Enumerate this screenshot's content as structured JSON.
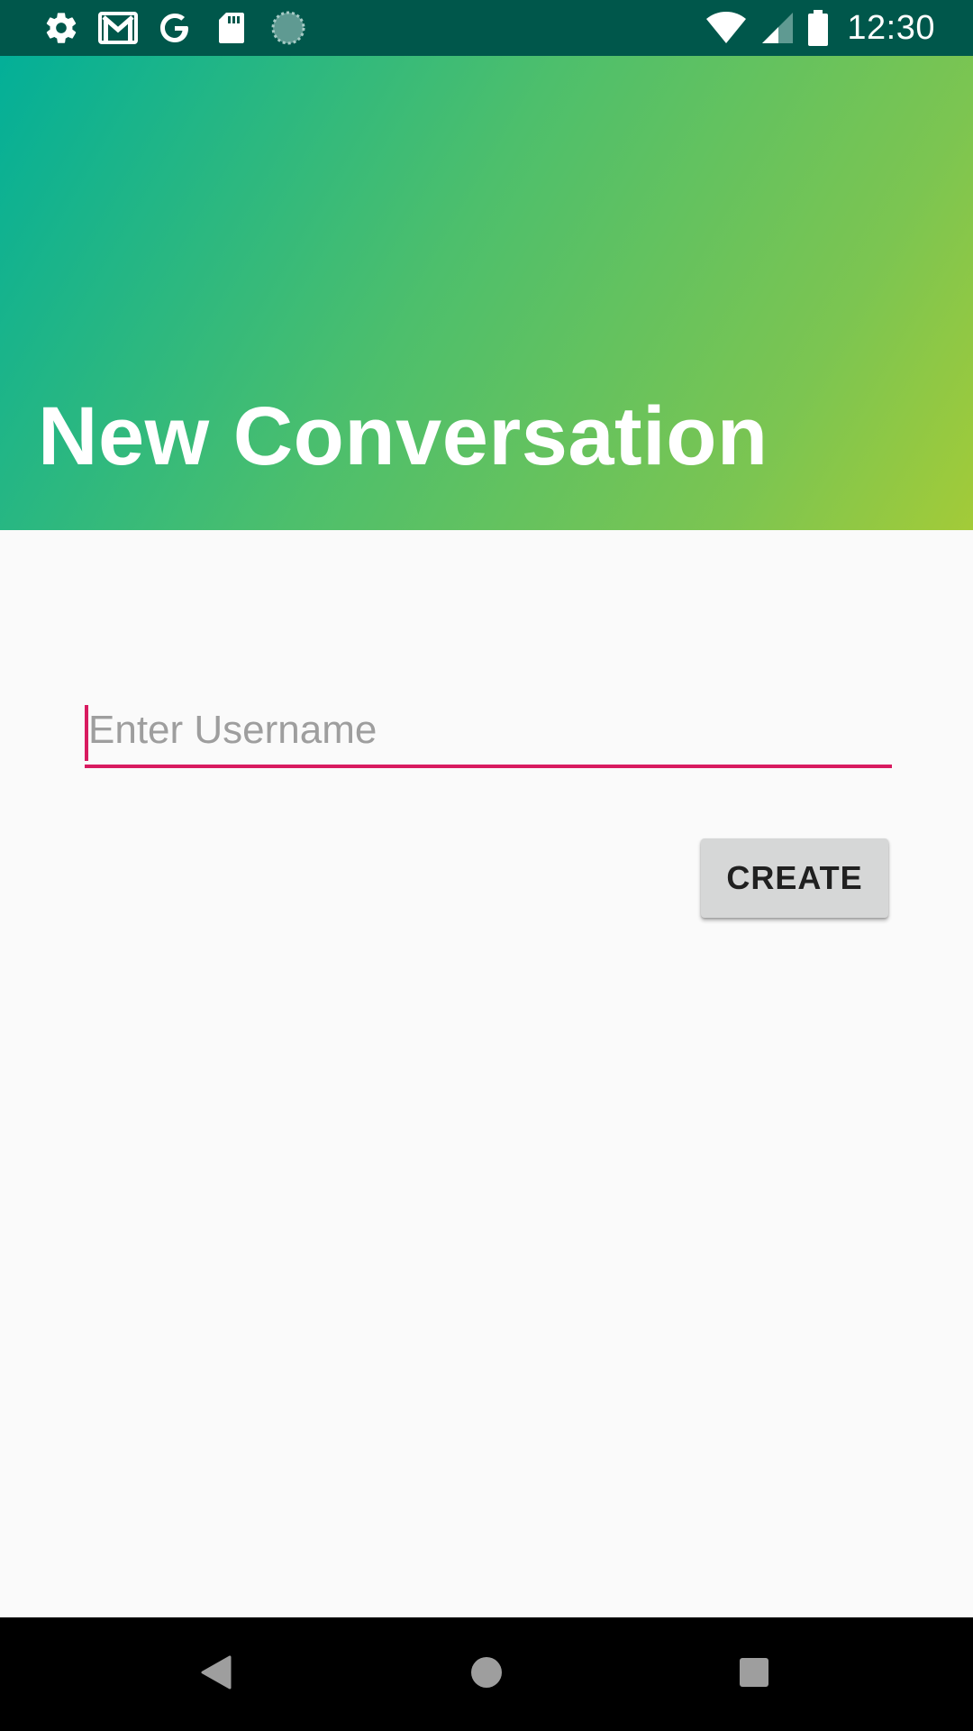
{
  "status_bar": {
    "time": "12:30",
    "left_icons": [
      "settings-icon",
      "gmail-icon",
      "google-icon",
      "sd-card-icon",
      "sync-icon"
    ],
    "right_icons": [
      "wifi-icon",
      "signal-icon",
      "battery-icon"
    ]
  },
  "header": {
    "title": "New Conversation"
  },
  "form": {
    "username_placeholder": "Enter Username",
    "username_value": "",
    "create_label": "CREATE"
  },
  "nav_bar": {
    "buttons": [
      "back-icon",
      "home-icon",
      "recents-icon"
    ]
  },
  "colors": {
    "status_bar": "#00574b",
    "gradient_start": "#03af98",
    "gradient_end": "#a3cb38",
    "accent": "#d81b60",
    "background": "#fafafa",
    "button": "#d6d7d7"
  }
}
